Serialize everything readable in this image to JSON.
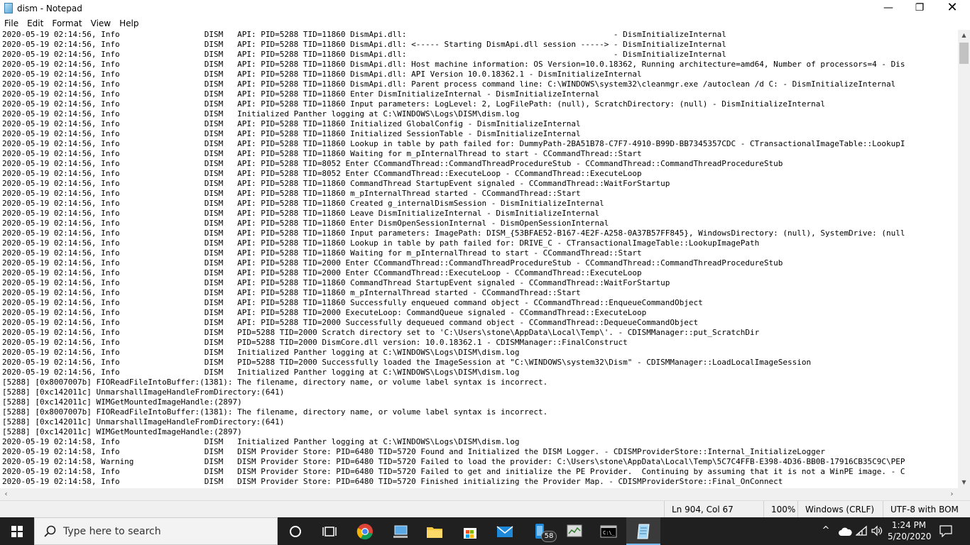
{
  "window": {
    "title": "dism - Notepad",
    "minimize_glyph": "—",
    "maximize_glyph": "❐",
    "close_glyph": "✕"
  },
  "menu": [
    "File",
    "Edit",
    "Format",
    "View",
    "Help"
  ],
  "editor": {
    "lines": [
      "2020-05-19 02:14:56, Info                  DISM   API: PID=5288 TID=11860 DismApi.dll:                                            - DismInitializeInternal",
      "2020-05-19 02:14:56, Info                  DISM   API: PID=5288 TID=11860 DismApi.dll: <----- Starting DismApi.dll session -----> - DismInitializeInternal",
      "2020-05-19 02:14:56, Info                  DISM   API: PID=5288 TID=11860 DismApi.dll:                                            - DismInitializeInternal",
      "2020-05-19 02:14:56, Info                  DISM   API: PID=5288 TID=11860 DismApi.dll: Host machine information: OS Version=10.0.18362, Running architecture=amd64, Number of processors=4 - Dis",
      "2020-05-19 02:14:56, Info                  DISM   API: PID=5288 TID=11860 DismApi.dll: API Version 10.0.18362.1 - DismInitializeInternal",
      "2020-05-19 02:14:56, Info                  DISM   API: PID=5288 TID=11860 DismApi.dll: Parent process command line: C:\\WINDOWS\\system32\\cleanmgr.exe /autoclean /d C: - DismInitializeInternal",
      "2020-05-19 02:14:56, Info                  DISM   API: PID=5288 TID=11860 Enter DismInitializeInternal - DismInitializeInternal",
      "2020-05-19 02:14:56, Info                  DISM   API: PID=5288 TID=11860 Input parameters: LogLevel: 2, LogFilePath: (null), ScratchDirectory: (null) - DismInitializeInternal",
      "2020-05-19 02:14:56, Info                  DISM   Initialized Panther logging at C:\\WINDOWS\\Logs\\DISM\\dism.log",
      "2020-05-19 02:14:56, Info                  DISM   API: PID=5288 TID=11860 Initialized GlobalConfig - DismInitializeInternal",
      "2020-05-19 02:14:56, Info                  DISM   API: PID=5288 TID=11860 Initialized SessionTable - DismInitializeInternal",
      "2020-05-19 02:14:56, Info                  DISM   API: PID=5288 TID=11860 Lookup in table by path failed for: DummyPath-2BA51B78-C7F7-4910-B99D-BB7345357CDC - CTransactionalImageTable::LookupI",
      "2020-05-19 02:14:56, Info                  DISM   API: PID=5288 TID=11860 Waiting for m_pInternalThread to start - CCommandThread::Start",
      "2020-05-19 02:14:56, Info                  DISM   API: PID=5288 TID=8052 Enter CCommandThread::CommandThreadProcedureStub - CCommandThread::CommandThreadProcedureStub",
      "2020-05-19 02:14:56, Info                  DISM   API: PID=5288 TID=8052 Enter CCommandThread::ExecuteLoop - CCommandThread::ExecuteLoop",
      "2020-05-19 02:14:56, Info                  DISM   API: PID=5288 TID=11860 CommandThread StartupEvent signaled - CCommandThread::WaitForStartup",
      "2020-05-19 02:14:56, Info                  DISM   API: PID=5288 TID=11860 m_pInternalThread started - CCommandThread::Start",
      "2020-05-19 02:14:56, Info                  DISM   API: PID=5288 TID=11860 Created g_internalDismSession - DismInitializeInternal",
      "2020-05-19 02:14:56, Info                  DISM   API: PID=5288 TID=11860 Leave DismInitializeInternal - DismInitializeInternal",
      "2020-05-19 02:14:56, Info                  DISM   API: PID=5288 TID=11860 Enter DismOpenSessionInternal - DismOpenSessionInternal",
      "2020-05-19 02:14:56, Info                  DISM   API: PID=5288 TID=11860 Input parameters: ImagePath: DISM_{53BFAE52-B167-4E2F-A258-0A37B57FF845}, WindowsDirectory: (null), SystemDrive: (null",
      "2020-05-19 02:14:56, Info                  DISM   API: PID=5288 TID=11860 Lookup in table by path failed for: DRIVE_C - CTransactionalImageTable::LookupImagePath",
      "2020-05-19 02:14:56, Info                  DISM   API: PID=5288 TID=11860 Waiting for m_pInternalThread to start - CCommandThread::Start",
      "2020-05-19 02:14:56, Info                  DISM   API: PID=5288 TID=2000 Enter CCommandThread::CommandThreadProcedureStub - CCommandThread::CommandThreadProcedureStub",
      "2020-05-19 02:14:56, Info                  DISM   API: PID=5288 TID=2000 Enter CCommandThread::ExecuteLoop - CCommandThread::ExecuteLoop",
      "2020-05-19 02:14:56, Info                  DISM   API: PID=5288 TID=11860 CommandThread StartupEvent signaled - CCommandThread::WaitForStartup",
      "2020-05-19 02:14:56, Info                  DISM   API: PID=5288 TID=11860 m_pInternalThread started - CCommandThread::Start",
      "2020-05-19 02:14:56, Info                  DISM   API: PID=5288 TID=11860 Successfully enqueued command object - CCommandThread::EnqueueCommandObject",
      "2020-05-19 02:14:56, Info                  DISM   API: PID=5288 TID=2000 ExecuteLoop: CommandQueue signaled - CCommandThread::ExecuteLoop",
      "2020-05-19 02:14:56, Info                  DISM   API: PID=5288 TID=2000 Successfully dequeued command object - CCommandThread::DequeueCommandObject",
      "2020-05-19 02:14:56, Info                  DISM   PID=5288 TID=2000 Scratch directory set to 'C:\\Users\\stone\\AppData\\Local\\Temp\\'. - CDISMManager::put_ScratchDir",
      "2020-05-19 02:14:56, Info                  DISM   PID=5288 TID=2000 DismCore.dll version: 10.0.18362.1 - CDISMManager::FinalConstruct",
      "2020-05-19 02:14:56, Info                  DISM   Initialized Panther logging at C:\\WINDOWS\\Logs\\DISM\\dism.log",
      "2020-05-19 02:14:56, Info                  DISM   PID=5288 TID=2000 Successfully loaded the ImageSession at \"C:\\WINDOWS\\system32\\Dism\" - CDISMManager::LoadLocalImageSession",
      "2020-05-19 02:14:56, Info                  DISM   Initialized Panther logging at C:\\WINDOWS\\Logs\\DISM\\dism.log",
      "[5288] [0x8007007b] FIOReadFileIntoBuffer:(1381): The filename, directory name, or volume label syntax is incorrect.",
      "[5288] [0xc142011c] UnmarshallImageHandleFromDirectory:(641)",
      "[5288] [0xc142011c] WIMGetMountedImageHandle:(2897)",
      "[5288] [0x8007007b] FIOReadFileIntoBuffer:(1381): The filename, directory name, or volume label syntax is incorrect.",
      "[5288] [0xc142011c] UnmarshallImageHandleFromDirectory:(641)",
      "[5288] [0xc142011c] WIMGetMountedImageHandle:(2897)",
      "2020-05-19 02:14:58, Info                  DISM   Initialized Panther logging at C:\\WINDOWS\\Logs\\DISM\\dism.log",
      "2020-05-19 02:14:58, Info                  DISM   DISM Provider Store: PID=6480 TID=5720 Found and Initialized the DISM Logger. - CDISMProviderStore::Internal_InitializeLogger",
      "2020-05-19 02:14:58, Warning               DISM   DISM Provider Store: PID=6480 TID=5720 Failed to load the provider: C:\\Users\\stone\\AppData\\Local\\Temp\\5C7C4FFB-E398-4D36-BB0B-17916CB35C9C\\PEP",
      "2020-05-19 02:14:58, Info                  DISM   DISM Provider Store: PID=6480 TID=5720 Failed to get and initialize the PE Provider.  Continuing by assuming that it is not a WinPE image. - C",
      "2020-05-19 02:14:58, Info                  DISM   DISM Provider Store: PID=6480 TID=5720 Finished initializing the Provider Map. - CDISMProviderStore::Final_OnConnect"
    ]
  },
  "scrollbars": {
    "up": "▲",
    "down": "▼",
    "left": "‹",
    "right": "›"
  },
  "statusbar": {
    "position": "Ln 904, Col 67",
    "zoom": "100%",
    "line_ending": "Windows (CRLF)",
    "encoding": "UTF-8 with BOM"
  },
  "taskbar": {
    "search_placeholder": "Type here to search",
    "badge_count": "58",
    "time": "1:24 PM",
    "date": "5/20/2020",
    "chevron_glyph": "^"
  }
}
